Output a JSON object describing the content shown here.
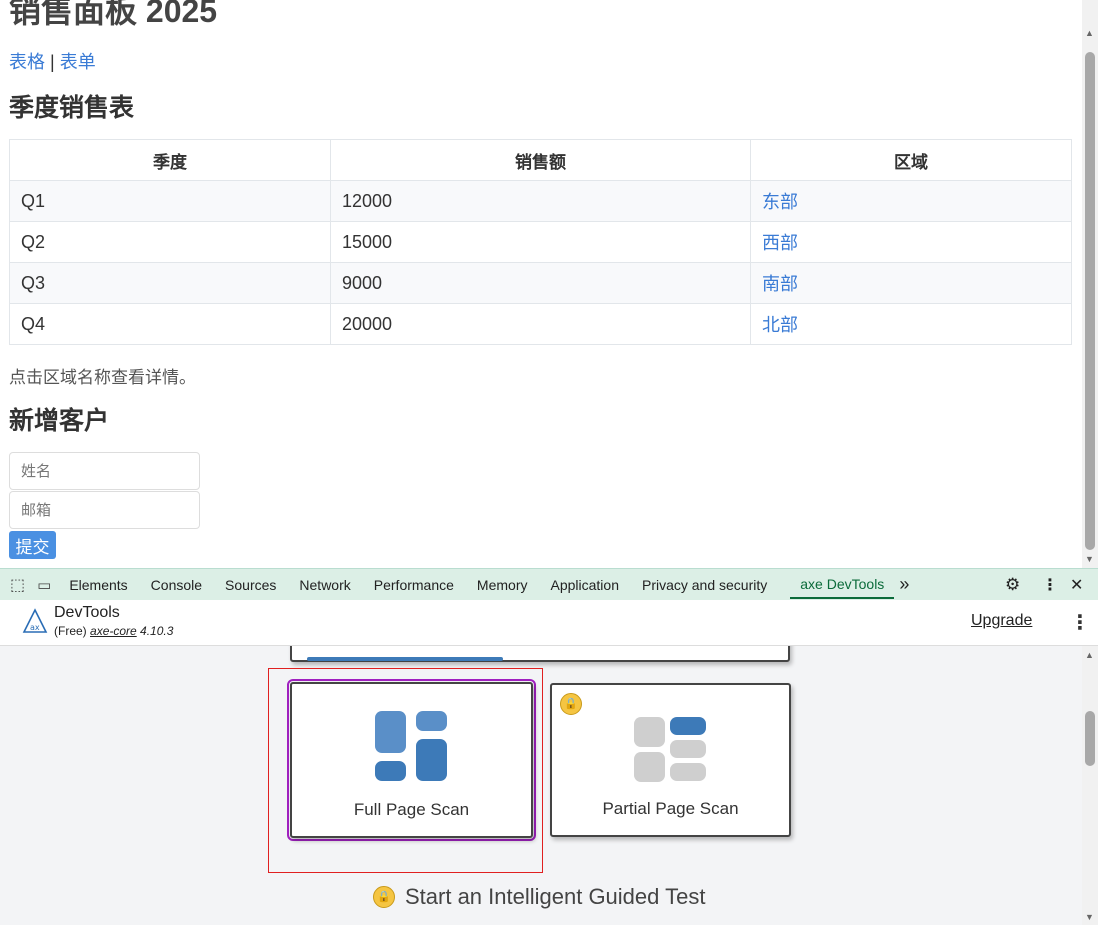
{
  "page": {
    "title": "销售面板 2025",
    "nav": {
      "link1": "表格",
      "sep": "|",
      "link2": "表单"
    },
    "table_heading": "季度销售表",
    "table": {
      "headers": [
        "季度",
        "销售额",
        "区域"
      ],
      "rows": [
        [
          "Q1",
          "12000",
          "东部"
        ],
        [
          "Q2",
          "15000",
          "西部"
        ],
        [
          "Q3",
          "9000",
          "南部"
        ],
        [
          "Q4",
          "20000",
          "北部"
        ]
      ]
    },
    "note": "点击区域名称查看详情。",
    "form_heading": "新增客户",
    "form": {
      "name_placeholder": "姓名",
      "email_placeholder": "邮箱",
      "submit": "提交"
    }
  },
  "devtools": {
    "tabs": [
      "Elements",
      "Console",
      "Sources",
      "Network",
      "Performance",
      "Memory",
      "Application",
      "Privacy and security",
      "axe DevTools"
    ],
    "more": "»"
  },
  "axe": {
    "brand": "DevTools",
    "plan": "(Free)",
    "core_link": "axe-core",
    "version": "4.10.3",
    "upgrade": "Upgrade",
    "cards": {
      "full": "Full Page Scan",
      "partial": "Partial Page Scan"
    },
    "guided": "Start an Intelligent Guided Test",
    "colors": {
      "blue": "#3d7ab8",
      "gray": "#cfcfcf",
      "focus": "#a020c0",
      "highlight": "#e02020"
    }
  }
}
